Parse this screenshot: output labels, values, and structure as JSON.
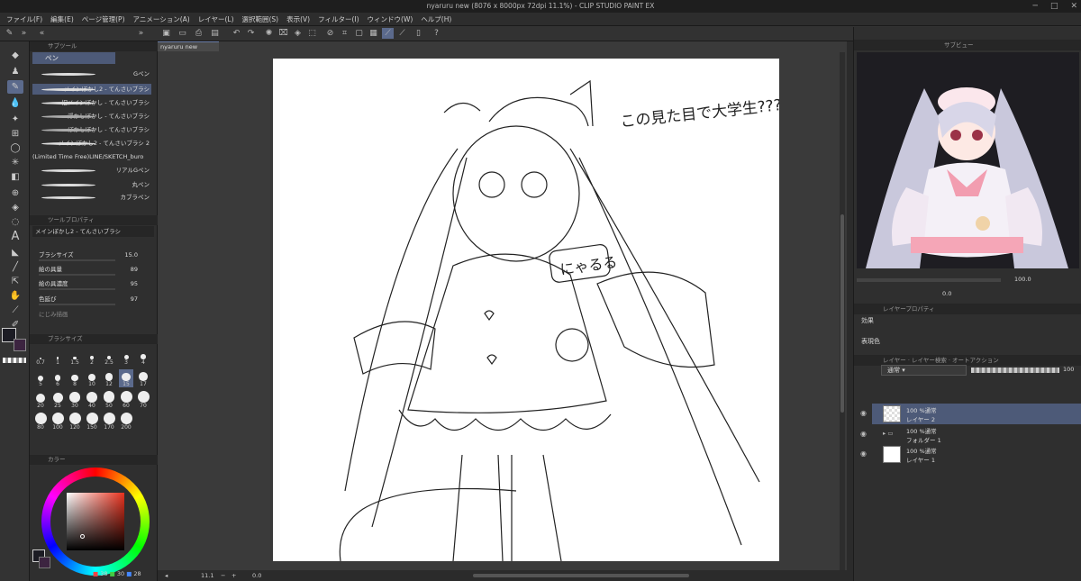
{
  "window": {
    "title": "nyaruru new (8076 x 8000px 72dpi 11.1%) - CLIP STUDIO PAINT EX"
  },
  "menu": [
    "ファイル(F)",
    "編集(E)",
    "ページ管理(P)",
    "アニメーション(A)",
    "レイヤー(L)",
    "選択範囲(S)",
    "表示(V)",
    "フィルター(I)",
    "ウィンドウ(W)",
    "ヘルプ(H)"
  ],
  "subtool": {
    "panel_title": "サブツール",
    "tab": "ペン",
    "brushes": [
      "Gペン",
      "メインぼかし2 - てんさいブラシ",
      "旧メインぼかし - てんさいブラシ",
      "浮かしぼかし - てんさいブラシ",
      "ぼかしぼかし - てんさいブラシ",
      "メインぼかし2 - てんさいブラシ 2",
      "(Limited Time Free)LINE/SKETCH_buro",
      "リアルGペン",
      "丸ペン",
      "カブラペン"
    ]
  },
  "toolprop": {
    "panel_title": "ツールプロパティ",
    "brush_name": "メインぼかし2 - てんさいブラシ",
    "props": [
      {
        "label": "ブラシサイズ",
        "value": "15.0"
      },
      {
        "label": "絵の具量",
        "value": "89"
      },
      {
        "label": "絵の具濃度",
        "value": "95"
      },
      {
        "label": "色延び",
        "value": "97"
      }
    ],
    "extra": "にじみ描画"
  },
  "brushsize": {
    "panel_title": "ブラシサイズ",
    "sizes": [
      "0.7",
      "1",
      "1.5",
      "2",
      "2.5",
      "3",
      "4",
      "5",
      "6",
      "8",
      "10",
      "12",
      "15",
      "17",
      "20",
      "25",
      "30",
      "40",
      "50",
      "60",
      "70",
      "80",
      "100",
      "120",
      "150",
      "170",
      "200"
    ],
    "selected": "15"
  },
  "color": {
    "panel_title": "カラー",
    "r": "38",
    "g": "30",
    "b": "28"
  },
  "document": {
    "tab": "nyaruru new",
    "annotation": "この見た目で大学生????",
    "tag": "にゃるる",
    "zoom": "11.1",
    "angle": "0.0"
  },
  "navigator": {
    "panel_title": "サブビュー",
    "zoom": "100.0",
    "angle": "0.0"
  },
  "layerprop": {
    "panel_title": "レイヤープロパティ",
    "effect_label": "効果",
    "color_label": "表現色"
  },
  "layers": {
    "panel_title": "レイヤー",
    "tab2": "レイヤー検索",
    "tab3": "オートアクション",
    "blend": "通常",
    "opacity": "100",
    "items": [
      {
        "mode": "100 %通常",
        "name": "レイヤー 2"
      },
      {
        "mode": "100 %通常",
        "name": "フォルダー 1"
      },
      {
        "mode": "100 %通常",
        "name": "レイヤー 1"
      }
    ]
  }
}
